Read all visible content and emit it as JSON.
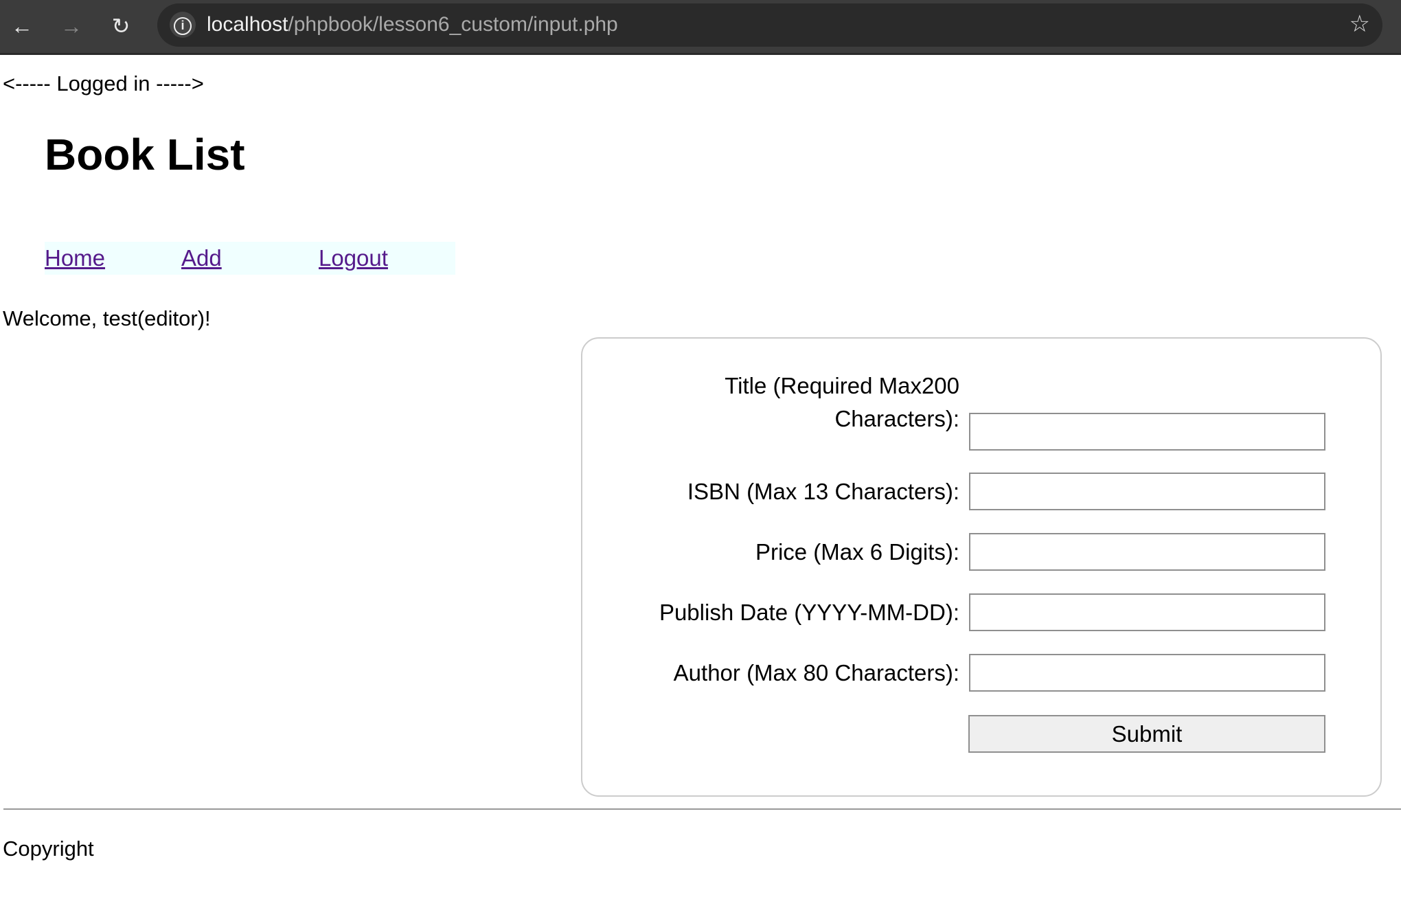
{
  "browser": {
    "url_host": "localhost",
    "url_path": "/phpbook/lesson6_custom/input.php",
    "icons": [
      "back-arrow-icon",
      "forward-arrow-icon",
      "reload-icon",
      "info-icon",
      "star-icon"
    ]
  },
  "page": {
    "logged_in_banner": "<----- Logged in ----->",
    "title": "Book List",
    "nav": {
      "home": "Home",
      "add": "Add",
      "logout": "Logout"
    },
    "welcome": "Welcome, test(editor)!",
    "form": {
      "title_label_line1": "Title (Required Max200",
      "title_label_line2": "Characters):",
      "isbn_label": "ISBN (Max 13 Characters):",
      "price_label": "Price (Max 6 Digits):",
      "date_label": "Publish Date (YYYY-MM-DD):",
      "author_label": "Author (Max 80 Characters):",
      "title_value": "",
      "isbn_value": "",
      "price_value": "",
      "date_value": "",
      "author_value": "",
      "submit_label": "Submit"
    },
    "footer": "Copyright"
  },
  "colors": {
    "link_visited": "#551a8b",
    "nav_bg": "#f0ffff",
    "browser_bar": "#3c3c3c"
  }
}
